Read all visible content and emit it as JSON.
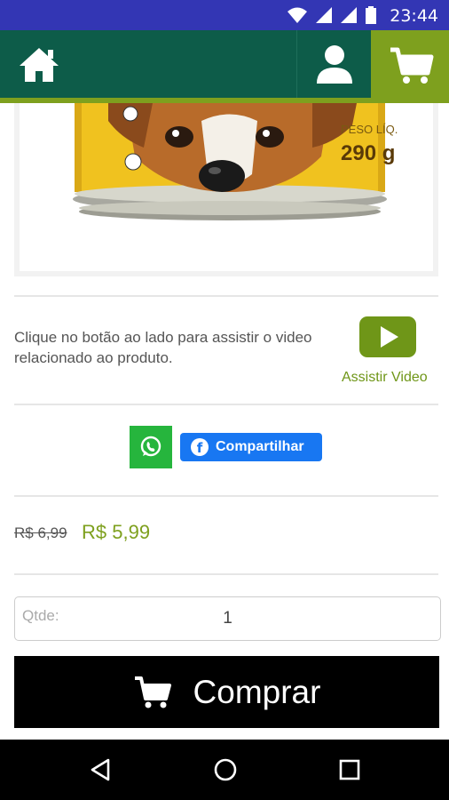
{
  "status_bar": {
    "time": "23:44"
  },
  "product": {
    "image_label_line1": "PESO LÍQ.",
    "image_label_line2": "290 g"
  },
  "video": {
    "description": "Clique no botão ao lado para assistir o video relacionado ao produto.",
    "link_label": "Assistir Video"
  },
  "share": {
    "facebook_label": "Compartilhar",
    "facebook_glyph": "f"
  },
  "price": {
    "old": "R$ 6,99",
    "new": "R$ 5,99"
  },
  "quantity": {
    "label": "Qtde:",
    "value": "1"
  },
  "buy_button": {
    "label": "Comprar"
  },
  "colors": {
    "status_bar": "#3336b4",
    "app_bar": "#0d5c49",
    "accent_green": "#7ea01e",
    "whatsapp": "#26b53d",
    "facebook": "#1877f2"
  }
}
